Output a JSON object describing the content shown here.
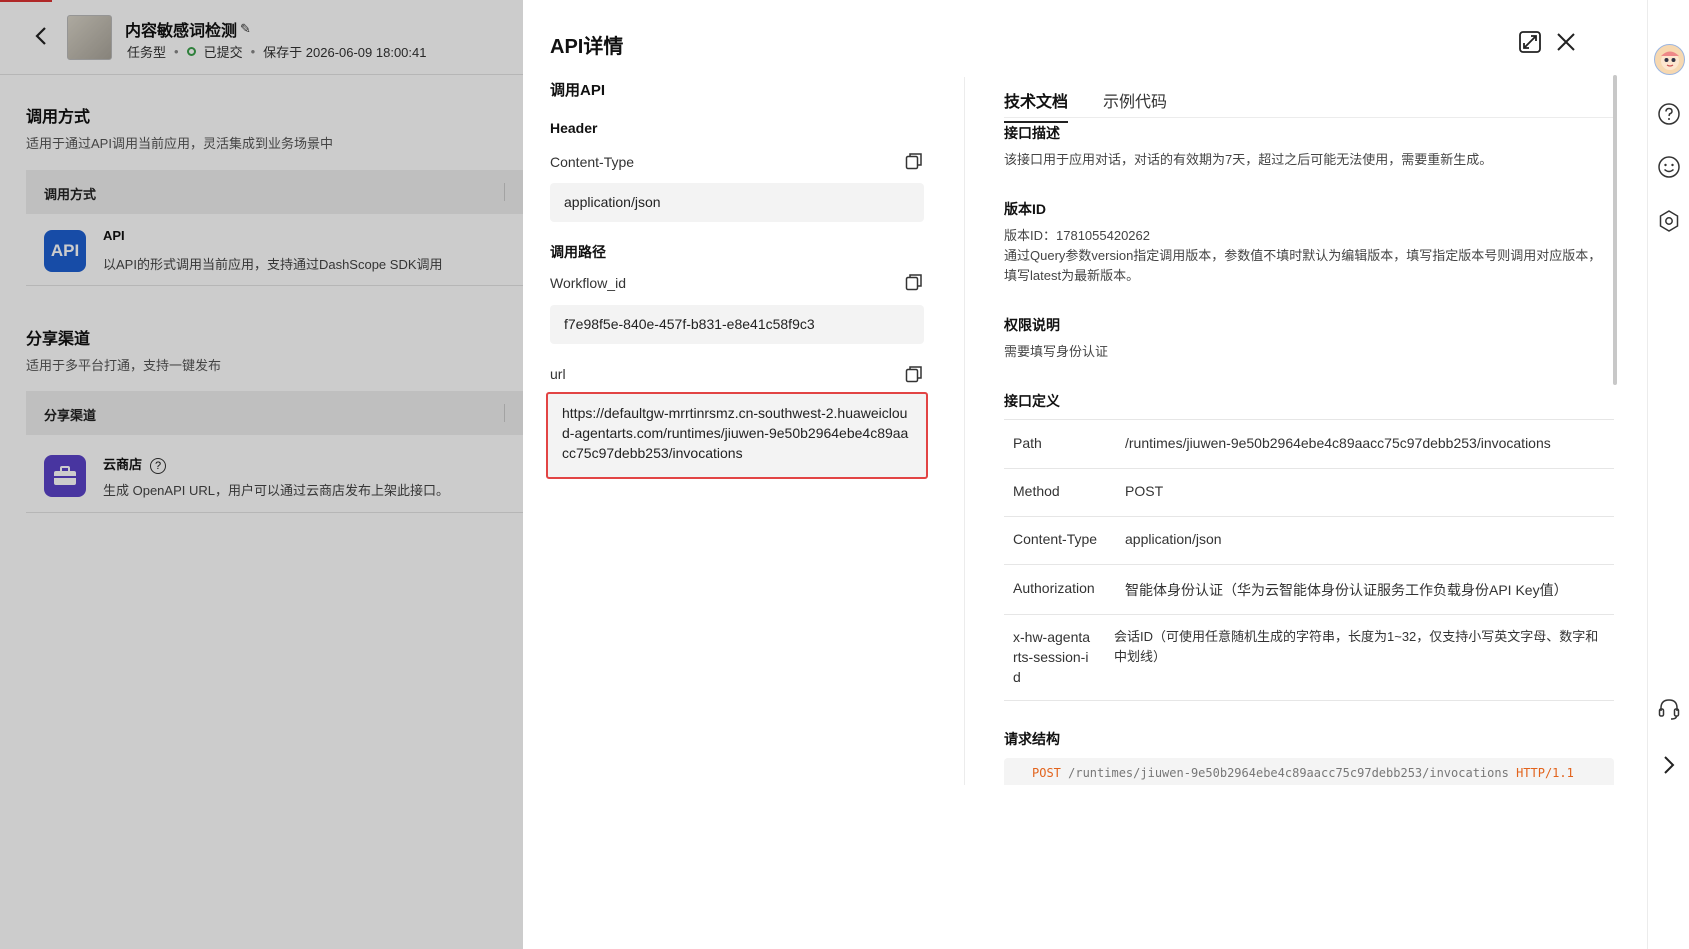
{
  "app": {
    "title": "内容敏感词检测",
    "type": "任务型",
    "status": "已提交",
    "saved": "保存于 2026-06-09 18:00:41"
  },
  "invoke": {
    "title": "调用方式",
    "subtitle": "适用于通过API调用当前应用，灵活集成到业务场景中",
    "table_header": "调用方式",
    "item_title": "API",
    "item_desc": "以API的形式调用当前应用，支持通过DashScope SDK调用",
    "badge": "API"
  },
  "share": {
    "title": "分享渠道",
    "subtitle": "适用于多平台打通，支持一键发布",
    "table_header": "分享渠道",
    "item_title": "云商店",
    "item_desc": "生成 OpenAPI URL，用户可以通过云商店发布上架此接口。"
  },
  "drawer": {
    "title": "API详情",
    "invoke_api": "调用API",
    "header_label": "Header",
    "content_type_label": "Content-Type",
    "content_type_value": "application/json",
    "path_label": "调用路径",
    "workflow_label": "Workflow_id",
    "workflow_value": "f7e98f5e-840e-457f-b831-e8e41c58f9c3",
    "url_label": "url",
    "url_value": "https://defaultgw-mrrtinrsmz.cn-southwest-2.huaweicloud-agentarts.com/runtimes/jiuwen-9e50b2964ebe4c89aacc75c97debb253/invocations"
  },
  "docs": {
    "tabs": [
      "技术文档",
      "示例代码"
    ],
    "desc_title": "接口描述",
    "desc_text": "该接口用于应用对话，对话的有效期为7天，超过之后可能无法使用，需要重新生成。",
    "version_title": "版本ID",
    "version_id": "版本ID：1781055420262",
    "version_text": "通过Query参数version指定调用版本，参数值不填时默认为编辑版本，填写指定版本号则调用对应版本，填写latest为最新版本。",
    "auth_title": "权限说明",
    "auth_text": "需要填写身份认证",
    "def_title": "接口定义",
    "def_rows": [
      {
        "key": "Path",
        "value": "/runtimes/jiuwen-9e50b2964ebe4c89aacc75c97debb253/invocations"
      },
      {
        "key": "Method",
        "value": "POST"
      },
      {
        "key": "Content-Type",
        "value": "application/json"
      },
      {
        "key": "Authorization",
        "value": "智能体身份认证（华为云智能体身份认证服务工作负载身份API Key值）"
      },
      {
        "key": "x-hw-agentarts-session-id",
        "value": "会话ID（可使用任意随机生成的字符串，长度为1~32，仅支持小写英文字母、数字和中划线）"
      }
    ],
    "request_title": "请求结构",
    "code_method": "POST",
    "code_path": " /runtimes/jiuwen-9e50b2964ebe4c89aacc75c97debb253/invocations ",
    "code_proto": "HTTP/1.1"
  },
  "toolbar": {
    "icons": [
      "avatar",
      "help-icon",
      "smile-icon",
      "settings-icon",
      "headset-icon",
      "chevron-right-icon"
    ]
  },
  "colors": {
    "api_badge": "#1d5fd1",
    "store_badge": "#5b43c8",
    "status_ok": "#3aa14a",
    "highlight_border": "#e24444"
  }
}
